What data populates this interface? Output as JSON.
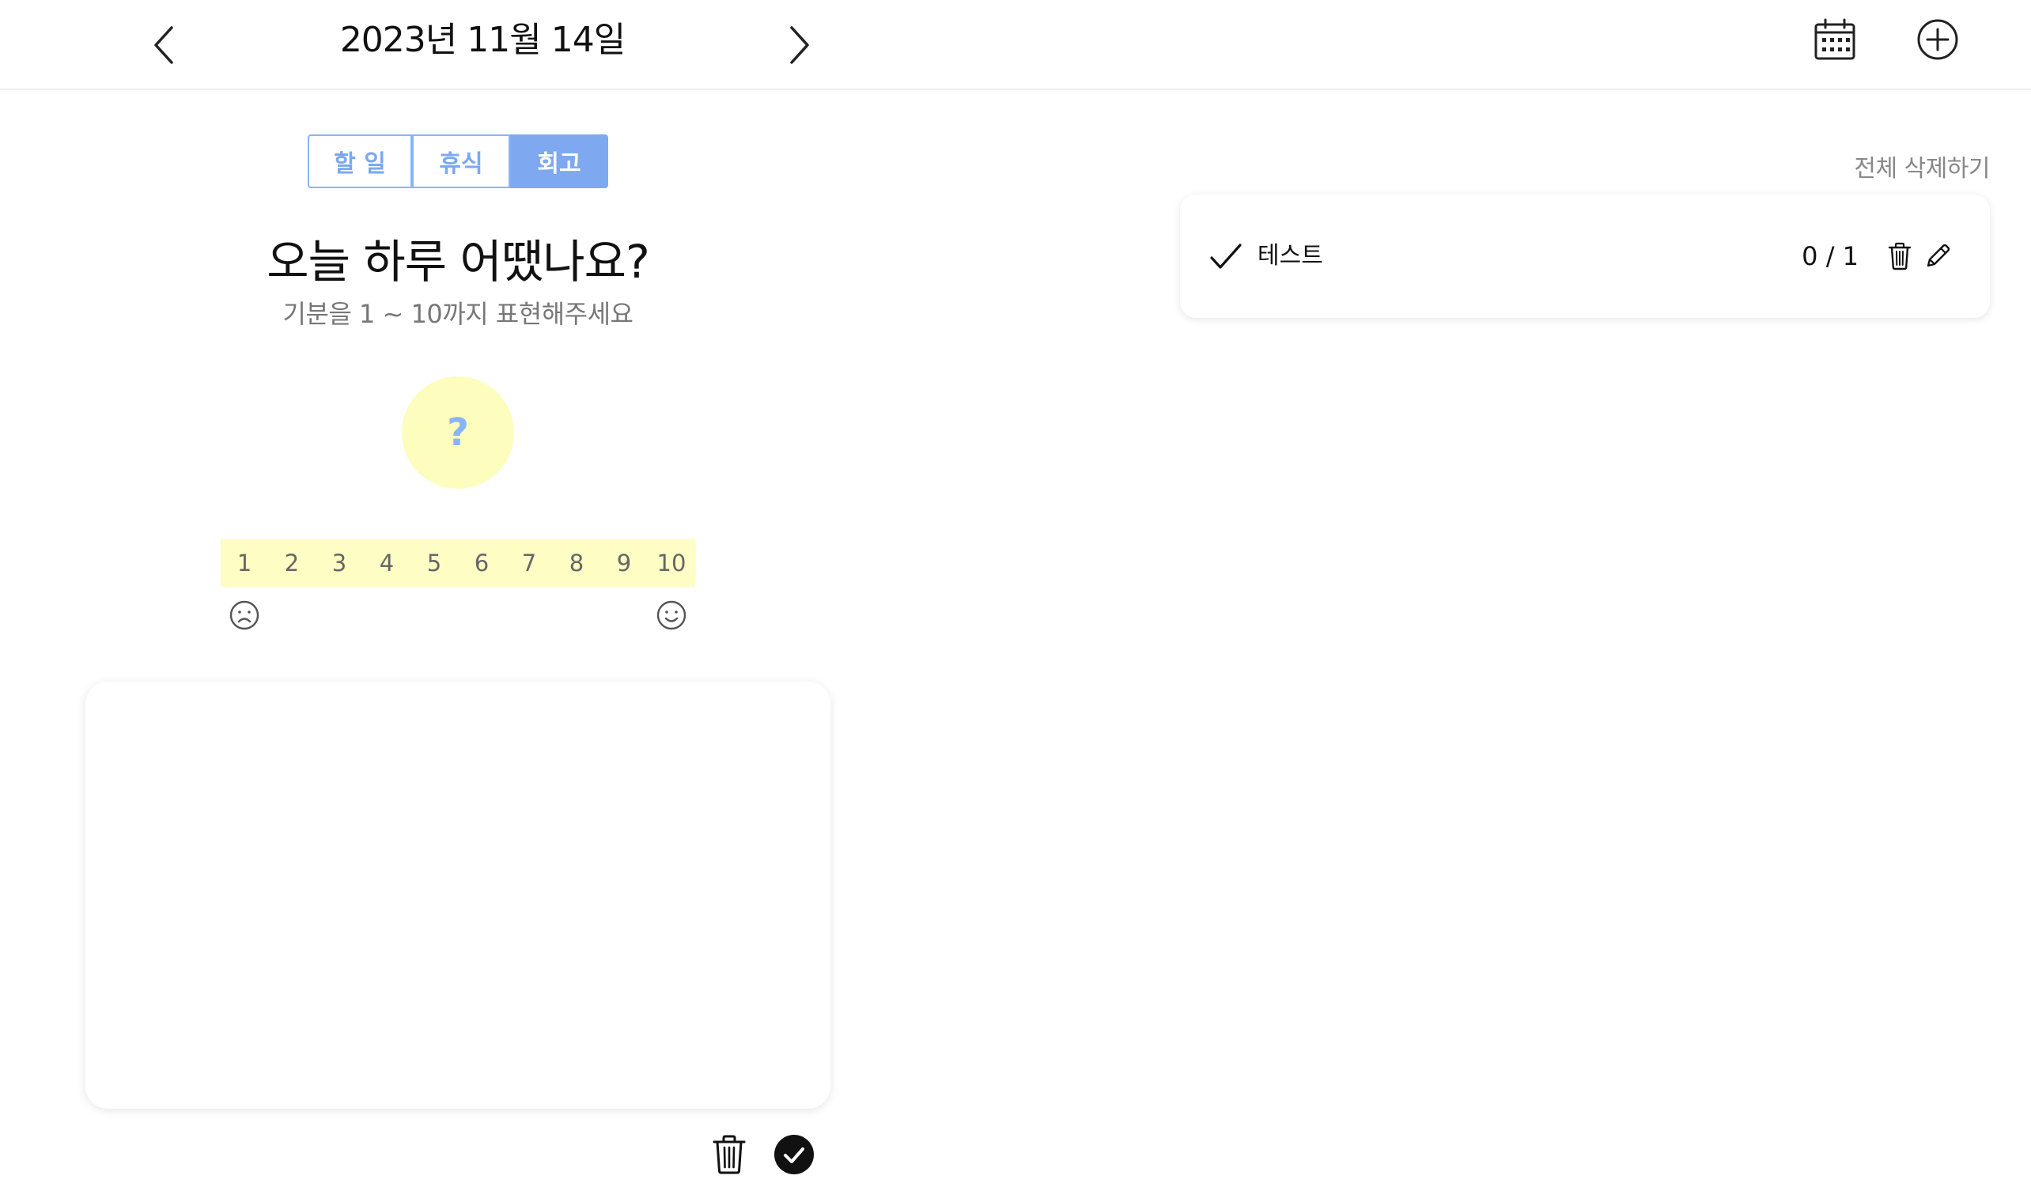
{
  "header": {
    "date": "2023년 11월 14일",
    "prev_icon": "chevron-left-icon",
    "next_icon": "chevron-right-icon",
    "calendar_icon": "calendar-icon",
    "add_icon": "plus-circle-icon"
  },
  "tabs": [
    {
      "label": "할 일",
      "active": false
    },
    {
      "label": "휴식",
      "active": false
    },
    {
      "label": "회고",
      "active": true
    }
  ],
  "reflection": {
    "question": "오늘 하루 어땠나요?",
    "subtitle": "기분을 1 ~ 10까지 표현해주세요",
    "mood_value": "?",
    "scale": [
      "1",
      "2",
      "3",
      "4",
      "5",
      "6",
      "7",
      "8",
      "9",
      "10"
    ],
    "low_icon": "sad-face-icon",
    "high_icon": "happy-face-icon",
    "memo_text": ""
  },
  "actions": {
    "trash_icon": "trash-icon",
    "confirm_icon": "check-circle-icon"
  },
  "todo_panel": {
    "delete_all_label": "전체 삭제하기",
    "items": [
      {
        "label": "테스트",
        "count": "0 / 1"
      }
    ]
  },
  "colors": {
    "accent_blue": "#7ea9f0",
    "scale_yellow": "#fdfdc4",
    "mood_circle": "#fdfdbe"
  }
}
